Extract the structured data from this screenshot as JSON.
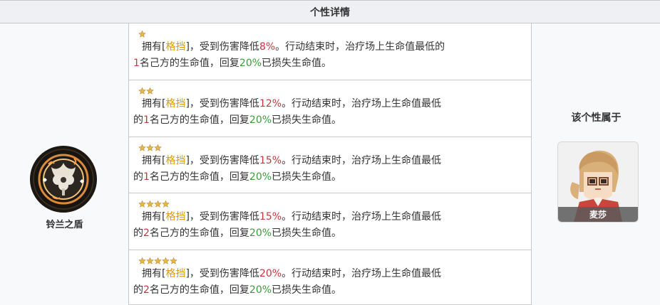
{
  "header": {
    "title": "个性详情"
  },
  "trait": {
    "name": "铃兰之盾",
    "icon": "lily-shield-icon"
  },
  "levels": [
    {
      "stars": 1,
      "pre": "拥有[",
      "kw": "格挡",
      "mid": "]，受到伤害降低",
      "reduce": "8%",
      "post1": "。行动结束时，治疗场上生命值最低的",
      "count": "1",
      "post2": "名己方的生命值，回复",
      "heal": "20%",
      "post3": "已损失生命值。"
    },
    {
      "stars": 2,
      "pre": "拥有[",
      "kw": "格挡",
      "mid": "]，受到伤害降低",
      "reduce": "12%",
      "post1": "。行动结束时，治疗场上生命值最低",
      "pre2": "的",
      "count": "1",
      "post2": "名己方的生命值，回复",
      "heal": "20%",
      "post3": "已损失生命值。"
    },
    {
      "stars": 3,
      "pre": "拥有[",
      "kw": "格挡",
      "mid": "]，受到伤害降低",
      "reduce": "15%",
      "post1": "。行动结束时，治疗场上生命值最低",
      "pre2": "的",
      "count": "1",
      "post2": "名己方的生命值，回复",
      "heal": "20%",
      "post3": "已损失生命值。"
    },
    {
      "stars": 4,
      "pre": "拥有[",
      "kw": "格挡",
      "mid": "]，受到伤害降低",
      "reduce": "15%",
      "post1": "。行动结束时，治疗场上生命值最低",
      "pre2": "的",
      "count": "2",
      "post2": "名己方的生命值，回复",
      "heal": "20%",
      "post3": "已损失生命值。"
    },
    {
      "stars": 5,
      "pre": "拥有[",
      "kw": "格挡",
      "mid": "]，受到伤害降低",
      "reduce": "20%",
      "post1": "。行动结束时，治疗场上生命值最低",
      "pre2": "的",
      "count": "2",
      "post2": "名己方的生命值，回复",
      "heal": "20%",
      "post3": "已损失生命值。"
    }
  ],
  "owner": {
    "label": "该个性属于",
    "character_name": "麦莎",
    "avatar_icon": "character-portrait-icon"
  },
  "colors": {
    "keyword": "#e39a00",
    "reduce": "#c8373c",
    "heal": "#3c9a3c",
    "star": "#e8b54a"
  }
}
